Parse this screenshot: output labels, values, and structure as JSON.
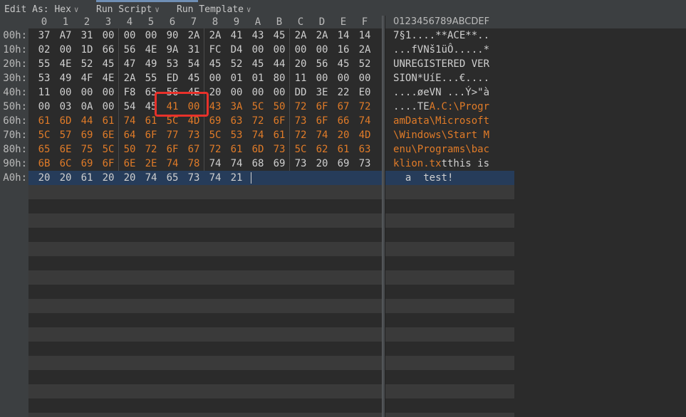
{
  "toolbar": {
    "items": [
      {
        "label": "Edit As: Hex",
        "chevron": "chevron-down-icon"
      },
      {
        "label": "Run Script",
        "chevron": "chevron-down-icon"
      },
      {
        "label": "Run Template",
        "chevron": "chevron-down-icon"
      }
    ],
    "chevron_glyph": "∨"
  },
  "columns": [
    "0",
    "1",
    "2",
    "3",
    "4",
    "5",
    "6",
    "7",
    "8",
    "9",
    "A",
    "B",
    "C",
    "D",
    "E",
    "F"
  ],
  "ascii_header": "0123456789ABCDEF",
  "rows": [
    {
      "offset": "00h:",
      "bytes": [
        "37",
        "A7",
        "31",
        "00",
        "00",
        "00",
        "90",
        "2A",
        "2A",
        "41",
        "43",
        "45",
        "2A",
        "2A",
        "14",
        "14"
      ],
      "ascii": "7§1....**ACE**.."
    },
    {
      "offset": "10h:",
      "bytes": [
        "02",
        "00",
        "1D",
        "66",
        "56",
        "4E",
        "9A",
        "31",
        "FC",
        "D4",
        "00",
        "00",
        "00",
        "00",
        "16",
        "2A"
      ],
      "ascii": "...fVNš1üÔ.....*"
    },
    {
      "offset": "20h:",
      "bytes": [
        "55",
        "4E",
        "52",
        "45",
        "47",
        "49",
        "53",
        "54",
        "45",
        "52",
        "45",
        "44",
        "20",
        "56",
        "45",
        "52"
      ],
      "ascii": "UNREGISTERED VER"
    },
    {
      "offset": "30h:",
      "bytes": [
        "53",
        "49",
        "4F",
        "4E",
        "2A",
        "55",
        "ED",
        "45",
        "00",
        "01",
        "01",
        "80",
        "11",
        "00",
        "00",
        "00"
      ],
      "ascii": "SION*UíE...€...."
    },
    {
      "offset": "40h:",
      "bytes": [
        "11",
        "00",
        "00",
        "00",
        "F8",
        "65",
        "56",
        "4E",
        "20",
        "00",
        "00",
        "00",
        "DD",
        "3E",
        "22",
        "E0"
      ],
      "ascii": "....øeVN ...Ý>\"à"
    },
    {
      "offset": "50h:",
      "bytes": [
        "00",
        "03",
        "0A",
        "00",
        "54",
        "45",
        "41",
        "00",
        "43",
        "3A",
        "5C",
        "50",
        "72",
        "6F",
        "67",
        "72"
      ],
      "ascii": "....TEA.C:\\Progr"
    },
    {
      "offset": "60h:",
      "bytes": [
        "61",
        "6D",
        "44",
        "61",
        "74",
        "61",
        "5C",
        "4D",
        "69",
        "63",
        "72",
        "6F",
        "73",
        "6F",
        "66",
        "74"
      ],
      "ascii": "amData\\Microsoft"
    },
    {
      "offset": "70h:",
      "bytes": [
        "5C",
        "57",
        "69",
        "6E",
        "64",
        "6F",
        "77",
        "73",
        "5C",
        "53",
        "74",
        "61",
        "72",
        "74",
        "20",
        "4D"
      ],
      "ascii": "\\Windows\\Start M"
    },
    {
      "offset": "80h:",
      "bytes": [
        "65",
        "6E",
        "75",
        "5C",
        "50",
        "72",
        "6F",
        "67",
        "72",
        "61",
        "6D",
        "73",
        "5C",
        "62",
        "61",
        "63"
      ],
      "ascii": "enu\\Programs\\bac"
    },
    {
      "offset": "90h:",
      "bytes": [
        "6B",
        "6C",
        "69",
        "6F",
        "6E",
        "2E",
        "74",
        "78",
        "74",
        "74",
        "68",
        "69",
        "73",
        "20",
        "69",
        "73"
      ],
      "ascii": "klion.txtthis is"
    },
    {
      "offset": "A0h:",
      "bytes": [
        "20",
        "20",
        "61",
        "20",
        "20",
        "74",
        "65",
        "73",
        "74",
        "21"
      ],
      "ascii": "  a  test!"
    }
  ],
  "highlight": {
    "start": 86,
    "end": 152,
    "color": "#e07b28"
  },
  "selected_row": 10,
  "annotation": {
    "color": "#e8312a",
    "bytes": [
      "41",
      "00"
    ]
  },
  "theme": {
    "background": "#2b2b2b",
    "band": "#3a3a3a",
    "gutter": "#3c3f41",
    "text": "#cfcfcf",
    "selection": "#263c5a"
  }
}
